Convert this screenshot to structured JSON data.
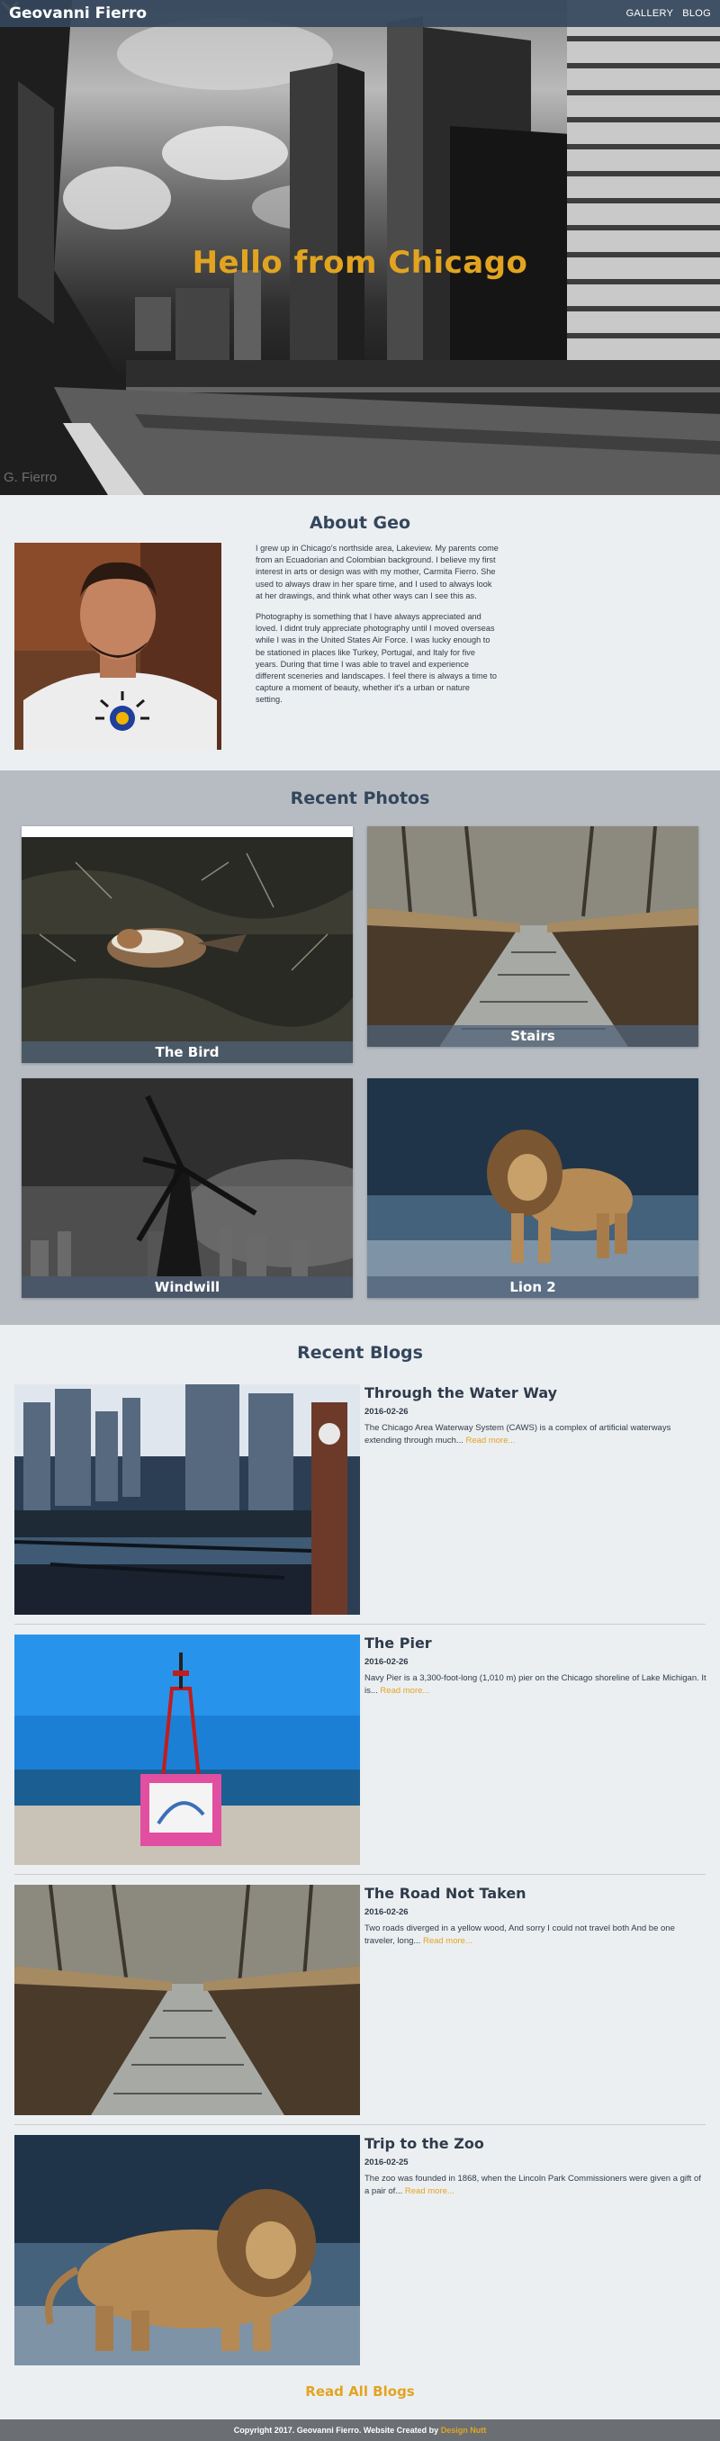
{
  "navbar": {
    "brand": "Geovanni Fierro",
    "links": [
      "GALLERY",
      "BLOG"
    ]
  },
  "hero": {
    "title": "Hello from Chicago",
    "scroll_icon": "chevron-down-icon",
    "watermark": "G. Fierro"
  },
  "about": {
    "title": "About Geo",
    "paragraphs": [
      "I grew up in Chicago's northside area, Lakeview. My parents come from an Ecuadorian and Colombian background. I believe my first interest in arts or design was with my mother, Carmita Fierro. She used to always draw in her spare time, and I used to always look at her drawings, and think what other ways can I see this as.",
      "Photography is something that I have always appreciated and loved. I didnt truly appreciate photography until I moved overseas while I was in the United States Air Force. I was lucky enough to be stationed in places like Turkey, Portugal, and Italy for five years. During that time I was able to travel and experience different sceneries and landscapes. I feel there is always a time to capture a moment of beauty, whether it's a urban or nature setting."
    ]
  },
  "photos": {
    "title": "Recent Photos",
    "items": [
      {
        "caption": "The Bird"
      },
      {
        "caption": "Stairs"
      },
      {
        "caption": "Windwill"
      },
      {
        "caption": "Lion 2"
      }
    ]
  },
  "blogs": {
    "title": "Recent Blogs",
    "items": [
      {
        "title": "Through the Water Way",
        "date": "2016-02-26",
        "excerpt": "The Chicago Area Waterway System (CAWS) is a complex of artificial waterways extending through much...",
        "read_more": "Read more..."
      },
      {
        "title": "The Pier",
        "date": "2016-02-26",
        "excerpt": "Navy Pier is a 3,300-foot-long (1,010 m) pier on the Chicago shoreline of Lake Michigan. It is...",
        "read_more": "Read more..."
      },
      {
        "title": "The Road Not Taken",
        "date": "2016-02-26",
        "excerpt": "Two roads diverged in a yellow wood, And sorry I could not travel both And be one traveler, long...",
        "read_more": "Read more..."
      },
      {
        "title": "Trip to the Zoo",
        "date": "2016-02-25",
        "excerpt": "The zoo was founded in 1868, when the Lincoln Park Commissioners were given a gift of a pair of...",
        "read_more": "Read more..."
      }
    ],
    "read_all": "Read All Blogs"
  },
  "footer": {
    "text": "Copyright 2017. Geovanni Fierro. Website Created by",
    "credit": "Design Nutt"
  },
  "colors": {
    "accent": "#e2a420",
    "navbar": "#34465c",
    "photos_bg": "#b7bcc3",
    "page_bg": "#eceff1",
    "footer": "#6b6f74"
  }
}
